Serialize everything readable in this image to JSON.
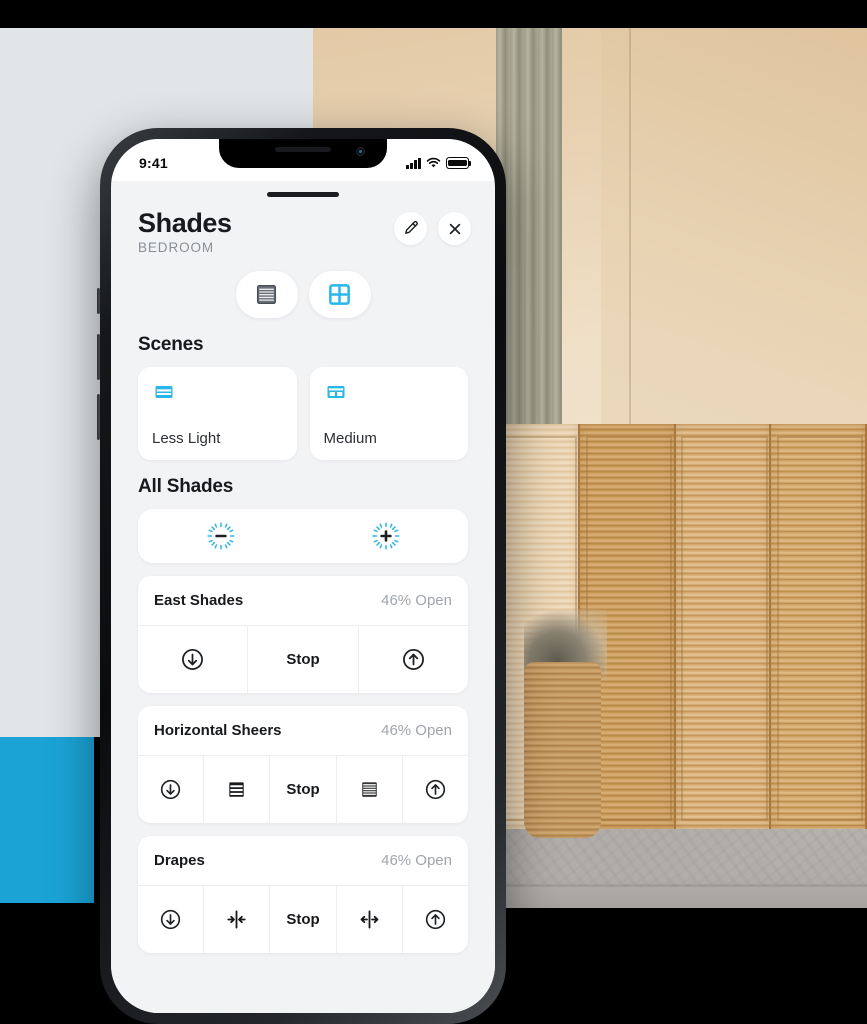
{
  "background": {
    "panel_color": "#E1E5E7",
    "accent_block_color": "#1BA3D6",
    "photo_alt": "bedroom-with-wooden-louvered-screen"
  },
  "phone": {
    "status_bar": {
      "time": "9:41",
      "signal_icon": "cellular-signal-icon",
      "wifi_icon": "wifi-icon",
      "battery_icon": "battery-icon"
    },
    "grabber": "sheet-drag-handle"
  },
  "header": {
    "title": "Shades",
    "subtitle": "BEDROOM",
    "edit_icon": "pencil-icon",
    "close_icon": "close-icon"
  },
  "view_toggle": {
    "options": [
      {
        "id": "list-view",
        "icon": "blinds-icon",
        "active": false
      },
      {
        "id": "grid-view",
        "icon": "window-grid-icon",
        "active": true
      }
    ],
    "active_color": "#29B6E8",
    "inactive_color": "#5A5F66"
  },
  "scenes": {
    "heading": "Scenes",
    "items": [
      {
        "label": "Less Light",
        "icon": "shade-half-icon"
      },
      {
        "label": "Medium",
        "icon": "shade-medium-icon"
      }
    ]
  },
  "all_shades": {
    "heading": "All Shades",
    "controls": [
      {
        "id": "decrease-light",
        "icon": "sun-minus-icon",
        "label": ""
      },
      {
        "id": "increase-light",
        "icon": "sun-plus-icon",
        "label": ""
      }
    ]
  },
  "devices": [
    {
      "name": "East Shades",
      "state": "46% Open",
      "controls": [
        {
          "id": "close-down",
          "icon": "arrow-down-circle-icon",
          "label": ""
        },
        {
          "id": "stop",
          "icon": "",
          "label": "Stop"
        },
        {
          "id": "open-up",
          "icon": "arrow-up-circle-icon",
          "label": ""
        }
      ]
    },
    {
      "name": "Horizontal Sheers",
      "state": "46% Open",
      "controls": [
        {
          "id": "close-down",
          "icon": "arrow-down-circle-icon",
          "label": ""
        },
        {
          "id": "vanes-open",
          "icon": "slats-open-icon",
          "label": ""
        },
        {
          "id": "stop",
          "icon": "",
          "label": "Stop"
        },
        {
          "id": "vanes-closed",
          "icon": "slats-closed-icon",
          "label": ""
        },
        {
          "id": "open-up",
          "icon": "arrow-up-circle-icon",
          "label": ""
        }
      ]
    },
    {
      "name": "Drapes",
      "state": "46% Open",
      "controls": [
        {
          "id": "close-down",
          "icon": "arrow-down-circle-icon",
          "label": ""
        },
        {
          "id": "drapes-close",
          "icon": "arrows-inward-icon",
          "label": ""
        },
        {
          "id": "stop",
          "icon": "",
          "label": "Stop"
        },
        {
          "id": "drapes-open",
          "icon": "arrows-outward-icon",
          "label": ""
        },
        {
          "id": "open-up",
          "icon": "arrow-up-circle-icon",
          "label": ""
        }
      ]
    }
  ]
}
